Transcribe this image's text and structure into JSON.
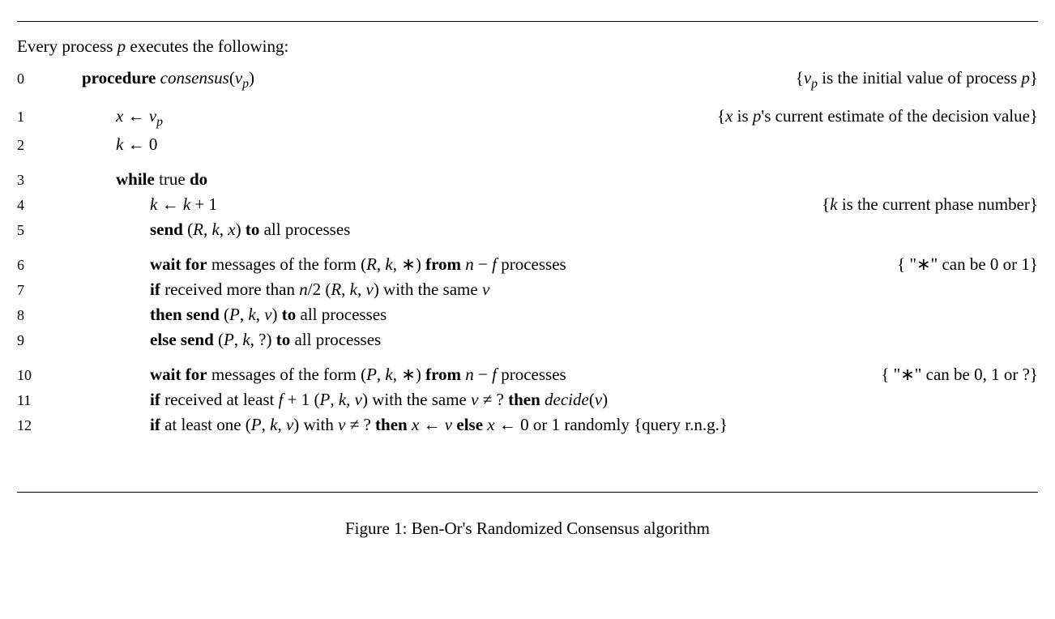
{
  "intro": "Every process p executes the following:",
  "lines": {
    "l0": {
      "num": "0",
      "body_html": "<b>procedure</b> <i>consensus</i>(<i>v<sub>p</sub></i>)",
      "comment_html": "{<i>v<sub>p</sub></i> is the initial value of process <i>p</i>}"
    },
    "l1": {
      "num": "1",
      "body_html": "<i>x</i> ← <i>v<sub>p</sub></i>",
      "comment_html": "{<i>x</i> is <i>p</i>'s current estimate of the decision value}"
    },
    "l2": {
      "num": "2",
      "body_html": "<i>k</i> ← 0",
      "comment_html": ""
    },
    "l3": {
      "num": "3",
      "body_html": "<b>while</b> true <b>do</b>",
      "comment_html": ""
    },
    "l4": {
      "num": "4",
      "body_html": "<i>k</i> ← <i>k</i> + 1",
      "comment_html": "{<i>k</i> is the current phase number}"
    },
    "l5": {
      "num": "5",
      "body_html": "<b>send</b> (<i>R</i>, <i>k</i>, <i>x</i>) <b>to</b> all processes",
      "comment_html": ""
    },
    "l6": {
      "num": "6",
      "body_html": "<b>wait for</b> messages of the form (<i>R</i>, <i>k</i>, ∗) <b>from</b> <i>n</i> − <i>f</i> processes",
      "comment_html": "{ \"∗\" can be 0 or 1}"
    },
    "l7": {
      "num": "7",
      "body_html": "<b>if</b> received more than <i>n</i>/2 (<i>R</i>, <i>k</i>, <i>v</i>) with the same <i>v</i>",
      "comment_html": ""
    },
    "l8": {
      "num": "8",
      "body_html": "<b>then send</b> (<i>P</i>, <i>k</i>, <i>v</i>) <b>to</b> all processes",
      "comment_html": ""
    },
    "l9": {
      "num": "9",
      "body_html": "<b>else send</b> (<i>P</i>, <i>k</i>, ?) <b>to</b> all processes",
      "comment_html": ""
    },
    "l10": {
      "num": "10",
      "body_html": "<b>wait for</b> messages of the form (<i>P</i>, <i>k</i>, ∗) <b>from</b> <i>n</i> − <i>f</i> processes",
      "comment_html": "{ \"∗\" can be 0, 1 or ?}"
    },
    "l11": {
      "num": "11",
      "body_html": "<b>if</b> received at least <i>f</i> + 1 (<i>P</i>, <i>k</i>, <i>v</i>) with the same <i>v</i> ≠ ? <b>then</b> <i>decide</i>(<i>v</i>)",
      "comment_html": ""
    },
    "l12": {
      "num": "12",
      "body_html": "<b>if</b> at least one (<i>P</i>, <i>k</i>, <i>v</i>) with <i>v</i> ≠ ? <b>then</b> <i>x</i> ← <i>v</i> <b>else</b> <i>x</i> ← 0 or 1 randomly {query r.n.g.}",
      "comment_html": ""
    }
  },
  "caption": "Figure 1: Ben-Or's Randomized Consensus algorithm"
}
